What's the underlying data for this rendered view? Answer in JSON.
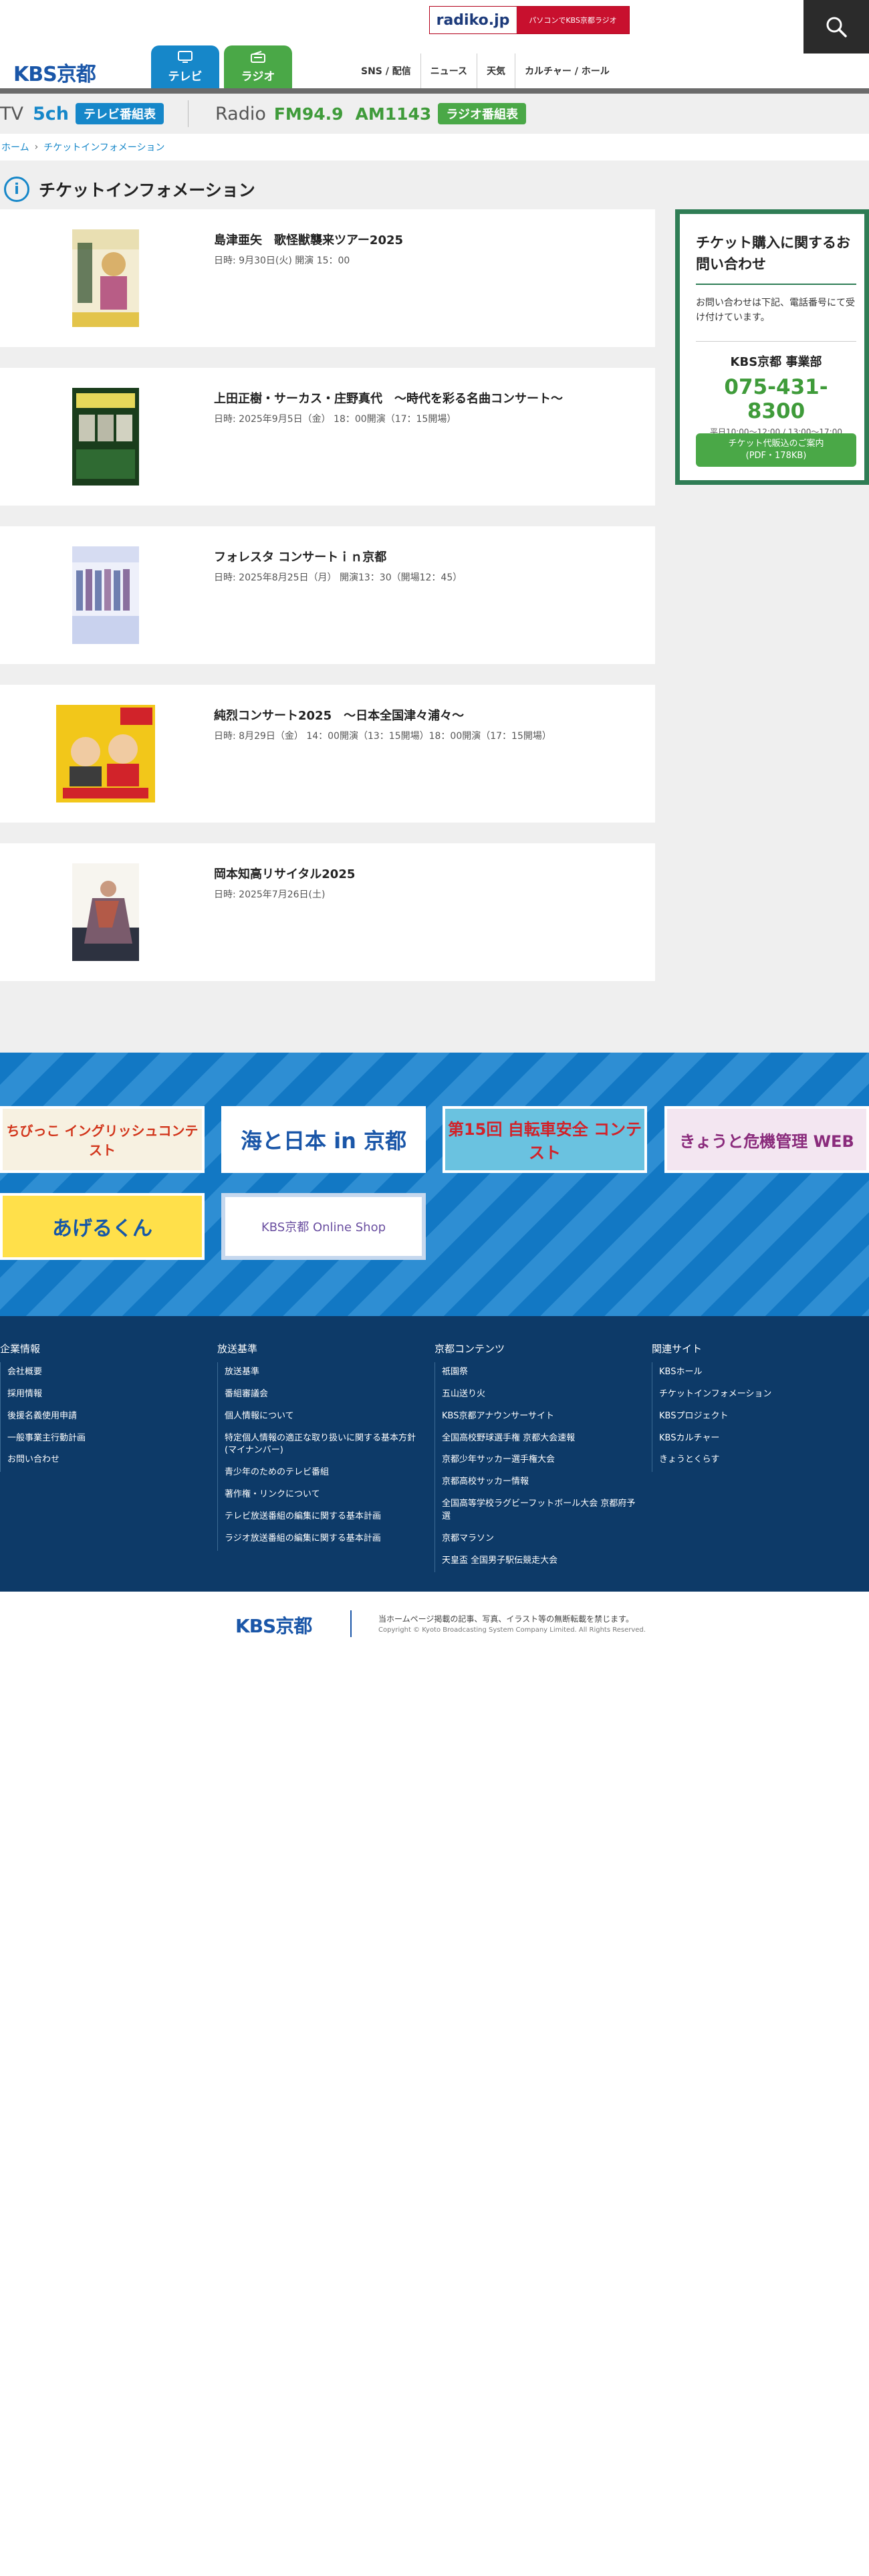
{
  "header": {
    "radiko": {
      "logo": "radiko.jp",
      "text": "パソコンでKBS京都ラジオ"
    },
    "logo": "KBS京都",
    "tabs": [
      {
        "label": "テレビ",
        "icon": "tv-icon"
      },
      {
        "label": "ラジオ",
        "icon": "radio-icon"
      }
    ],
    "gnav": [
      "SNS / 配信",
      "ニュース",
      "天気",
      "カルチャー / ホール"
    ],
    "search_icon": "search-icon"
  },
  "channel_bar": {
    "tv_label": "TV",
    "tv_channel": "5ch",
    "tv_guide": "テレビ番組表",
    "radio_label": "Radio",
    "fm": "FM94.9",
    "am": "AM1143",
    "radio_guide": "ラジオ番組表"
  },
  "breadcrumb": {
    "home": "ホーム",
    "current": "チケットインフォメーション"
  },
  "page_title": "チケットインフォメーション",
  "events": [
    {
      "title": "島津亜矢　歌怪獣襲来ツアー2025",
      "date": "日時: 9月30日(火) 開演 15：00"
    },
    {
      "title": "上田正樹・サーカス・庄野真代　～時代を彩る名曲コンサート～",
      "date": "日時: 2025年9月5日（金） 18：00開演（17：15開場）"
    },
    {
      "title": "フォレスタ コンサートｉｎ京都",
      "date": "日時: 2025年8月25日（月） 開演13：30（開場12：45）"
    },
    {
      "title": "純烈コンサート2025　～日本全国津々浦々～",
      "date": "日時: 8月29日（金） 14：00開演（13：15開場）18：00開演（17：15開場）"
    },
    {
      "title": "岡本知高リサイタル2025",
      "date": "日時: 2025年7月26日(土)"
    }
  ],
  "sidebar": {
    "title": "チケット購入に関するお問い合わせ",
    "text": "お問い合わせは下記、電話番号にて受け付けています。",
    "dept": "KBS京都 事業部",
    "tel": "075-431-8300",
    "hours": "平日10:00〜12:00 / 13:00〜17:00",
    "button_line1": "チケット代販込のご案内",
    "button_line2": "(PDF・178KB)"
  },
  "banners": [
    {
      "text": "ちびっこ イングリッシュコンテスト"
    },
    {
      "text": "海と日本 in 京都"
    },
    {
      "text": "第15回 自転車安全 コンテスト"
    },
    {
      "text": "きょうと危機管理 WEB"
    },
    {
      "text": "あげるくん"
    },
    {
      "text": "KBS京都 Online Shop"
    }
  ],
  "footer": {
    "columns": [
      {
        "heading": "企業情報",
        "items": [
          "会社概要",
          "採用情報",
          "後援名義使用申請",
          "一般事業主行動計画",
          "お問い合わせ"
        ]
      },
      {
        "heading": "放送基準",
        "items": [
          "放送基準",
          "番組審議会",
          "個人情報について",
          "特定個人情報の適正な取り扱いに関する基本方針(マイナンバー)",
          "青少年のためのテレビ番組",
          "著作権・リンクについて",
          "テレビ放送番組の編集に関する基本計画",
          "ラジオ放送番組の編集に関する基本計画"
        ]
      },
      {
        "heading": "京都コンテンツ",
        "items": [
          "祇園祭",
          "五山送り火",
          "KBS京都アナウンサーサイト",
          "全国高校野球選手権 京都大会速報",
          "京都少年サッカー選手権大会",
          "京都高校サッカー情報",
          "全国高等学校ラグビーフットボール大会 京都府予選",
          "京都マラソン",
          "天皇盃 全国男子駅伝競走大会"
        ]
      },
      {
        "heading": "関連サイト",
        "items": [
          "KBSホール",
          "チケットインフォメーション",
          "KBSプロジェクト",
          "KBSカルチャー",
          "きょうとくらす"
        ]
      }
    ],
    "logo": "KBS京都",
    "note": "当ホームページ掲載の記事、写真、イラスト等の無断転載を禁じます。",
    "copyright": "Copyright © Kyoto Broadcasting System Company Limited. All Rights Reserved."
  }
}
